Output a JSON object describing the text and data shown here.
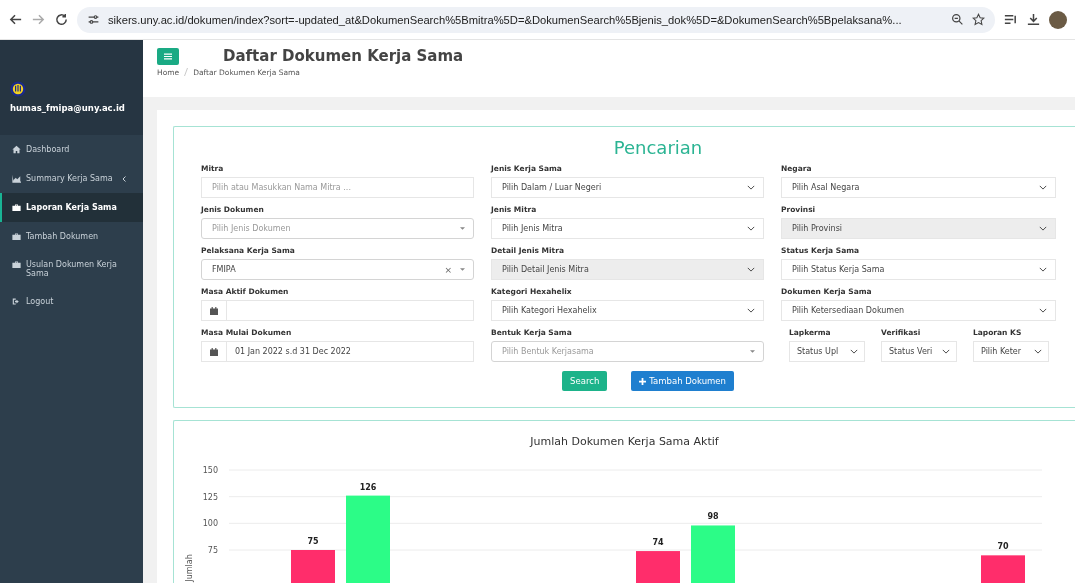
{
  "browser": {
    "url": "sikers.uny.ac.id/dokumen/index?sort=-updated_at&DokumenSearch%5Bmitra%5D=&DokumenSearch%5Bjenis_dok%5D=&DokumenSearch%5Bpelaksana%..."
  },
  "sidebar": {
    "user": "humas_fmipa@uny.ac.id",
    "items": [
      {
        "label": "Dashboard",
        "kind": "home",
        "selected": false,
        "expandable": false
      },
      {
        "label": "Summary Kerja Sama",
        "kind": "chart",
        "selected": false,
        "expandable": true
      },
      {
        "label": "Laporan Kerja Sama",
        "kind": "briefcase",
        "selected": true,
        "expandable": false
      },
      {
        "label": "Tambah Dokumen",
        "kind": "briefcase",
        "selected": false,
        "expandable": false
      },
      {
        "label": "Usulan Dokumen Kerja Sama",
        "kind": "briefcase",
        "selected": false,
        "expandable": false
      },
      {
        "label": "Logout",
        "kind": "logout",
        "selected": false,
        "expandable": false
      }
    ]
  },
  "header": {
    "title": "Daftar Dokumen Kerja Sama",
    "breadcrumb": [
      "Home",
      "Daftar Dokumen Kerja Sama"
    ]
  },
  "search": {
    "title": "Pencarian",
    "fields": [
      {
        "kind": "text",
        "label": "Mitra",
        "placeholder": "Pilih atau Masukkan Nama Mitra ..."
      },
      {
        "kind": "select",
        "label": "Jenis Kerja Sama",
        "value": "Pilih Dalam / Luar Negeri",
        "disabled": false
      },
      {
        "kind": "select",
        "label": "Negara",
        "value": "Pilih Asal Negara",
        "disabled": false
      },
      {
        "kind": "combo",
        "label": "Jenis Dokumen",
        "placeholder": "Pilih Jenis Dokumen"
      },
      {
        "kind": "select",
        "label": "Jenis Mitra",
        "value": "Pilih Jenis Mitra",
        "disabled": false
      },
      {
        "kind": "select",
        "label": "Provinsi",
        "value": "Pilih Provinsi",
        "disabled": true
      },
      {
        "kind": "combo",
        "label": "Pelaksana Kerja Sama",
        "value": "FMIPA",
        "clear": "×"
      },
      {
        "kind": "select",
        "label": "Detail Jenis Mitra",
        "value": "Pilih Detail Jenis Mitra",
        "disabled": true
      },
      {
        "kind": "select",
        "label": "Status Kerja Sama",
        "value": "Pilih Status Kerja Sama",
        "disabled": false
      },
      {
        "kind": "date",
        "label": "Masa Aktif Dokumen"
      },
      {
        "kind": "select",
        "label": "Kategori Hexahelix",
        "value": "Pilih Kategori Hexahelix",
        "disabled": false
      },
      {
        "kind": "select",
        "label": "Dokumen Kerja Sama",
        "value": "Pilih Ketersediaan Dokumen",
        "disabled": false
      },
      {
        "kind": "date",
        "label": "Masa Mulai Dokumen",
        "value": "01 Jan 2022 s.d 31 Dec 2022"
      },
      {
        "kind": "combo",
        "label": "Bentuk Kerja Sama",
        "placeholder": "Pilih Bentuk Kerjasama"
      },
      {
        "kind": "group",
        "items": [
          {
            "label": "Lapkerma",
            "value": "Status Upl"
          },
          {
            "label": "Verifikasi",
            "value": "Status Veri"
          },
          {
            "label": "Laporan KS",
            "value": "Pilih Keter"
          }
        ]
      }
    ],
    "buttons": [
      {
        "label": "Search",
        "kind": "search"
      },
      {
        "label": "Tambah Dokumen",
        "kind": "add"
      }
    ]
  },
  "chart": {
    "chart_data": {
      "type": "bar",
      "title": "Jumlah Dokumen Kerja Sama Aktif",
      "ylabel": "Jumlah",
      "ylim": [
        0,
        150
      ],
      "grid": true,
      "yticks": [
        75,
        100,
        125,
        150
      ],
      "data_labels": true,
      "series": [
        {
          "color": "#ff2d6b",
          "values": [
            75,
            74,
            70
          ]
        },
        {
          "color": "#2cfc87",
          "values": [
            126,
            98,
            null
          ]
        }
      ]
    }
  }
}
